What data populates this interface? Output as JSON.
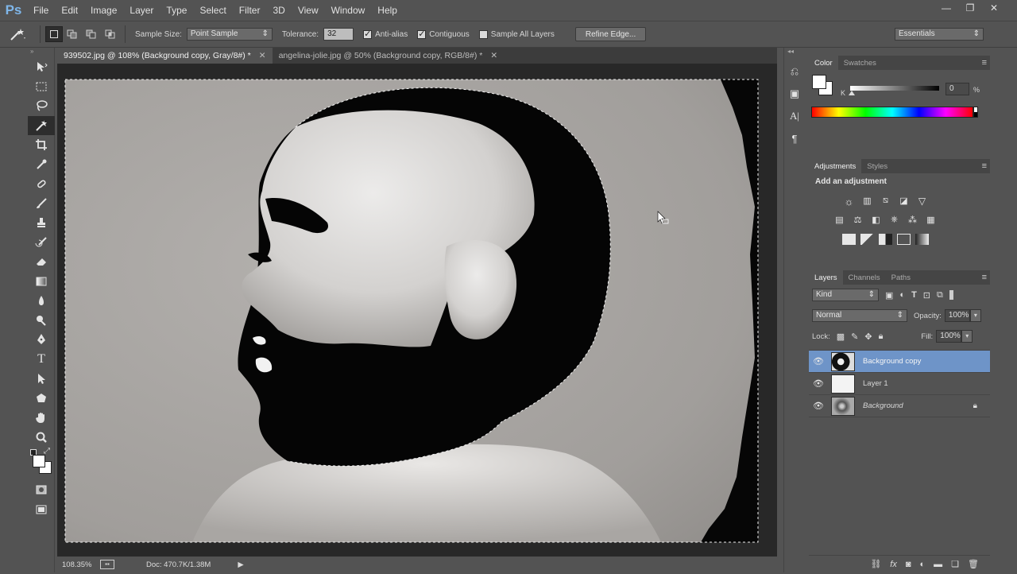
{
  "menu": {
    "logo": "Ps",
    "items": [
      "File",
      "Edit",
      "Image",
      "Layer",
      "Type",
      "Select",
      "Filter",
      "3D",
      "View",
      "Window",
      "Help"
    ]
  },
  "window_controls": {
    "minimize": "—",
    "restore": "❐",
    "close": "✕"
  },
  "options_bar": {
    "sample_size_label": "Sample Size:",
    "sample_size_value": "Point Sample",
    "tolerance_label": "Tolerance:",
    "tolerance_value": "32",
    "anti_alias_label": "Anti-alias",
    "anti_alias_checked": true,
    "contiguous_label": "Contiguous",
    "contiguous_checked": true,
    "sample_all_label": "Sample All Layers",
    "sample_all_checked": false,
    "refine_edge_label": "Refine Edge...",
    "workspace_value": "Essentials"
  },
  "tabs": [
    {
      "label": "939502.jpg @ 108% (Background copy, Gray/8#) *",
      "active": true
    },
    {
      "label": "angelina-jolie.jpg @ 50% (Background copy, RGB/8#) *",
      "active": false
    }
  ],
  "status_bar": {
    "zoom": "108.35%",
    "doc": "Doc: 470.7K/1.38M"
  },
  "color_panel": {
    "tabs": [
      "Color",
      "Swatches"
    ],
    "channel_label": "K",
    "value": "0",
    "unit": "%"
  },
  "adjustments_panel": {
    "tabs": [
      "Adjustments",
      "Styles"
    ],
    "heading": "Add an adjustment"
  },
  "layers_panel": {
    "tabs": [
      "Layers",
      "Channels",
      "Paths"
    ],
    "filter_kind": "Kind",
    "blend_mode": "Normal",
    "opacity_label": "Opacity:",
    "opacity_value": "100%",
    "lock_label": "Lock:",
    "fill_label": "Fill:",
    "fill_value": "100%",
    "layers": [
      {
        "name": "Background copy",
        "selected": true
      },
      {
        "name": "Layer 1",
        "selected": false
      },
      {
        "name": "Background",
        "selected": false,
        "locked": true
      }
    ]
  },
  "colors": {
    "ui_bg": "#535353",
    "canvas_bg": "#282828",
    "selection_highlight": "#6e94c8"
  }
}
